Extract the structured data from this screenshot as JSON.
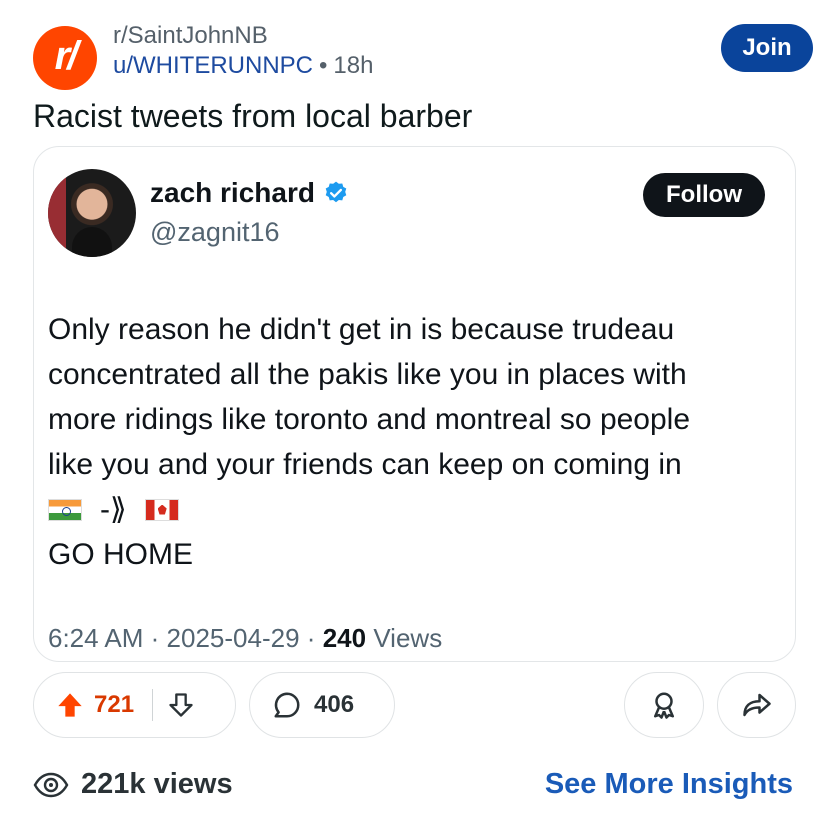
{
  "header": {
    "subreddit": "r/SaintJohnNB",
    "user": "u/WHITERUNNPC",
    "separator": "•",
    "age": "18h",
    "join_label": "Join",
    "icon_letter": "r/"
  },
  "post": {
    "title": "Racist tweets from local barber"
  },
  "tweet": {
    "author_name": "zach richard",
    "handle": "@zagnit16",
    "follow_label": "Follow",
    "text_lines": [
      "Only reason he didn't get in is because trudeau",
      "concentrated all the pakis like you in places with",
      "more ridings like toronto and montreal so people",
      "like you and your friends can keep on coming in"
    ],
    "arrow_text": "-⟫",
    "last_line": "GO HOME",
    "time": "6:24 AM",
    "date": "2025-04-29",
    "views_count": "240",
    "views_label": "Views",
    "meta_sep": "·"
  },
  "actions": {
    "upvotes": "721",
    "comments": "406"
  },
  "stats": {
    "views": "221k views",
    "insights_label": "See More Insights"
  },
  "colors": {
    "brand": "#ff4500",
    "join": "#0a449b",
    "upvote": "#d93900",
    "link": "#1a5bb8"
  }
}
